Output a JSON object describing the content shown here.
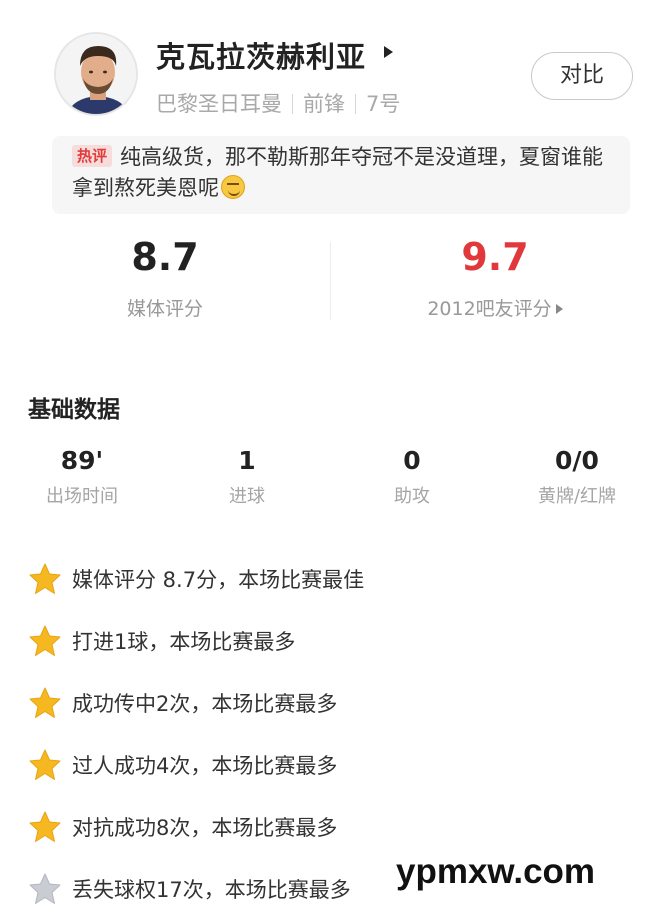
{
  "player": {
    "name": "克瓦拉茨赫利亚",
    "club": "巴黎圣日耳曼",
    "position": "前锋",
    "number": "7号"
  },
  "compare_button": "对比",
  "hot_comment": {
    "tag": "热评",
    "text": "纯高级货，那不勒斯那年夺冠不是没道理，夏窗谁能拿到熬死美恩呢",
    "emoji": "smirk-emoji"
  },
  "ratings": {
    "media": {
      "value": "8.7",
      "label": "媒体评分",
      "color": "#222222"
    },
    "fans": {
      "value": "9.7",
      "label": "2012吧友评分",
      "color": "#e0383b"
    }
  },
  "basic_stats": {
    "title": "基础数据",
    "items": [
      {
        "value": "89'",
        "label": "出场时间"
      },
      {
        "value": "1",
        "label": "进球"
      },
      {
        "value": "0",
        "label": "助攻"
      },
      {
        "value": "0/0",
        "label": "黄牌/红牌"
      }
    ]
  },
  "highlights": [
    {
      "text": "媒体评分 8.7分，本场比赛最佳",
      "icon": "gold-star-icon"
    },
    {
      "text": "打进1球，本场比赛最多",
      "icon": "gold-star-icon"
    },
    {
      "text": "成功传中2次，本场比赛最多",
      "icon": "gold-star-icon"
    },
    {
      "text": "过人成功4次，本场比赛最多",
      "icon": "gold-star-icon"
    },
    {
      "text": "对抗成功8次，本场比赛最多",
      "icon": "gold-star-icon"
    },
    {
      "text": "丢失球权17次，本场比赛最多",
      "icon": "gray-star-icon"
    }
  ],
  "watermark": "ypmxw.com",
  "colors": {
    "gold_star": "#f6b821",
    "gray_star": "#c9ccd3",
    "hot_tag": "#e03c3c"
  }
}
